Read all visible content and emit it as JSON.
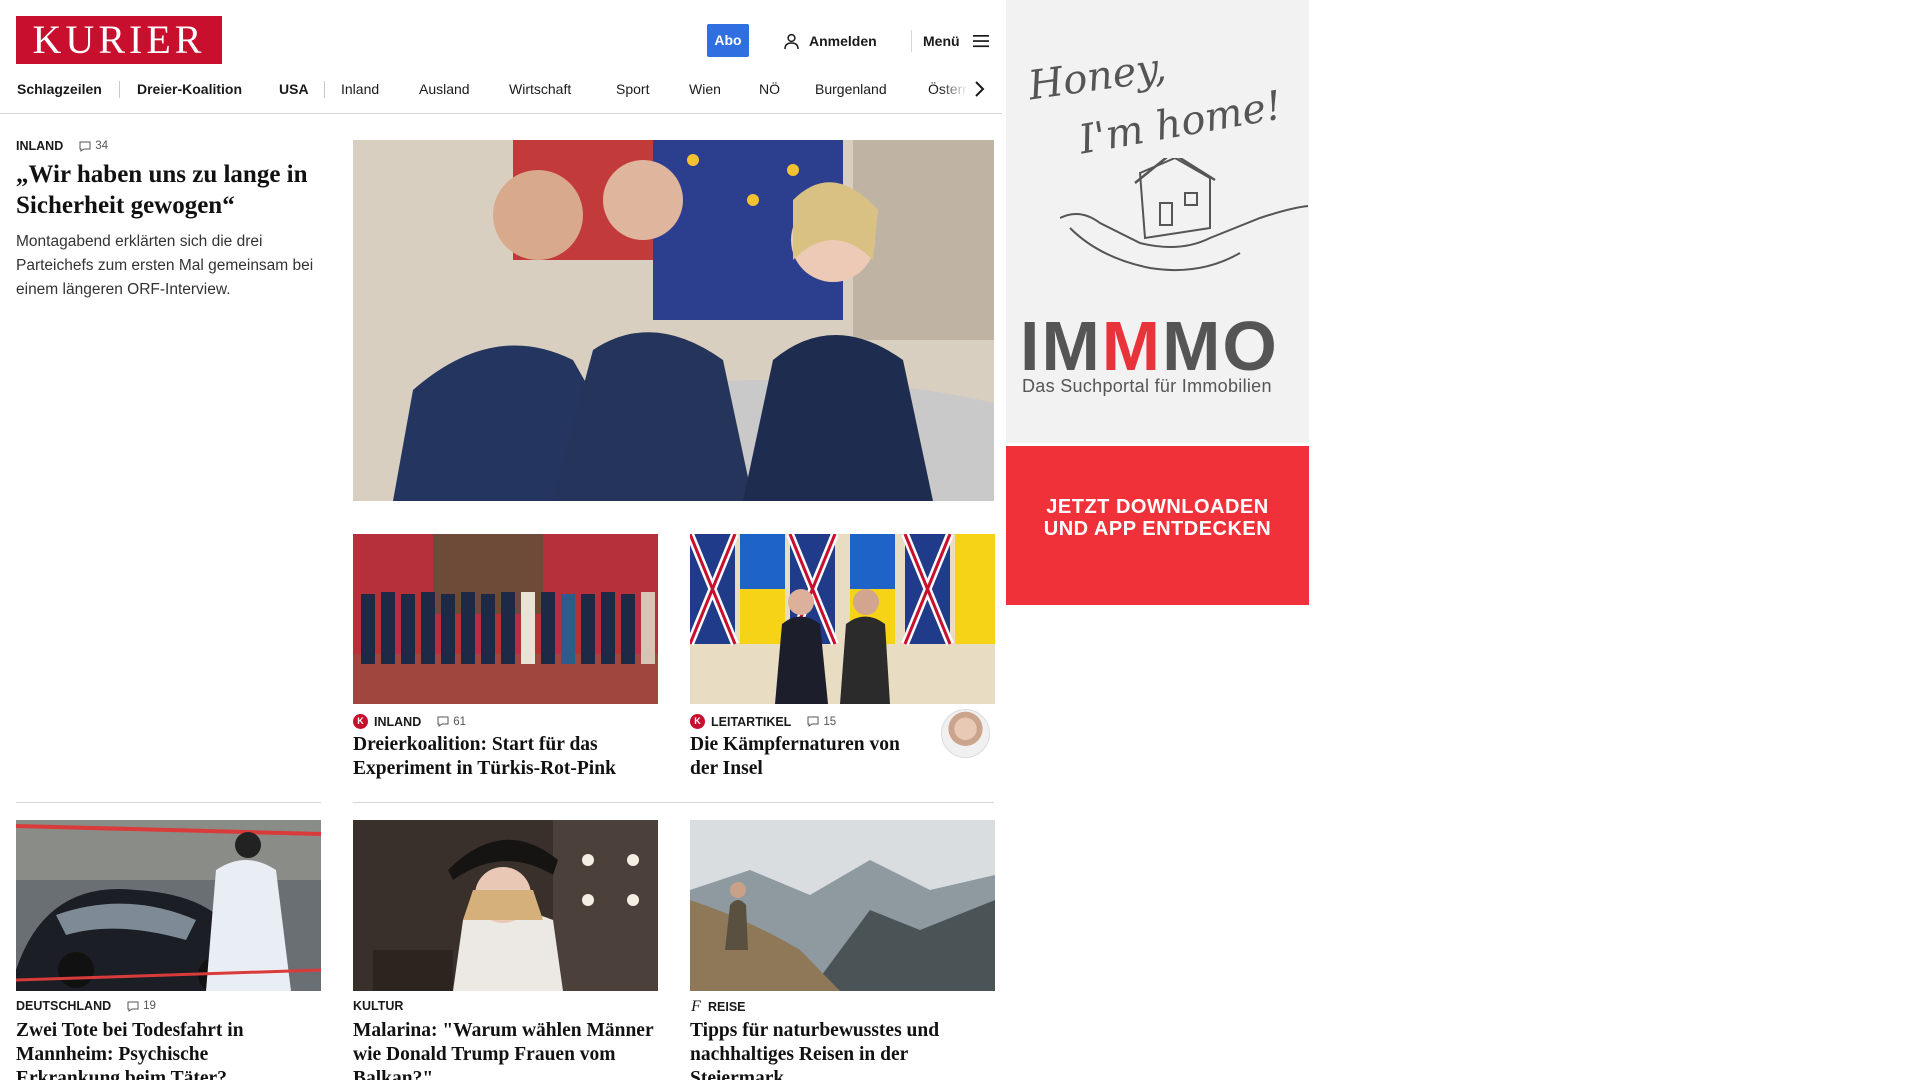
{
  "colors": {
    "brand": "#c8102e",
    "abo_button": "#2f6fe0",
    "ad_accent": "#f0313a"
  },
  "header": {
    "logo": "KURIER",
    "abo_label": "Abo",
    "login_label": "Anmelden",
    "menu_label": "Menü",
    "icons": [
      "user-icon",
      "hamburger-icon",
      "chevron-right-icon"
    ]
  },
  "nav": {
    "items": [
      "Schlagzeilen",
      "Dreier-Koalition",
      "USA",
      "Inland",
      "Ausland",
      "Wirtschaft",
      "Sport",
      "Wien",
      "NÖ",
      "Burgenland",
      "Österreich"
    ]
  },
  "articles": {
    "lead": {
      "section": "INLAND",
      "comments": "34",
      "headline": "„Wir haben uns zu lange in Sicherheit gewogen“",
      "teaser": "Montagabend erklärten sich die drei Parteichefs zum ersten Mal gemeinsam bei einem längeren ORF-Interview."
    },
    "a2": {
      "section": "INLAND",
      "comments": "61",
      "headline": "Dreierkoalition: Start für das Experiment in Türkis-Rot-Pink",
      "icon": "kurier-k-icon"
    },
    "a3": {
      "section": "LEITARTIKEL",
      "comments": "15",
      "headline": "Die Kämpfernaturen von der Insel",
      "icon": "kurier-k-icon"
    },
    "a4": {
      "section": "DEUTSCHLAND",
      "comments": "19",
      "headline": "Zwei Tote bei Todesfahrt in Mannheim: Psychische Erkrankung beim Täter?"
    },
    "a5": {
      "section": "KULTUR",
      "headline": "Malarina: \"Warum wählen Männer wie Donald Trump Frauen vom Balkan?\""
    },
    "a6": {
      "section": "REISE",
      "headline": "Tipps für naturbewusstes und nachhaltiges Reisen in der Steiermark",
      "icon": "reise-f-icon"
    }
  },
  "ad": {
    "hand_line1": "Honey,",
    "hand_line2": "I'm home!",
    "brand_a": "IM",
    "brand_b": "M",
    "brand_c": "MO",
    "tagline": "Das Suchportal für Immobilien",
    "cta_line1": "JETZT DOWNLOADEN",
    "cta_line2": "UND APP ENTDECKEN"
  }
}
